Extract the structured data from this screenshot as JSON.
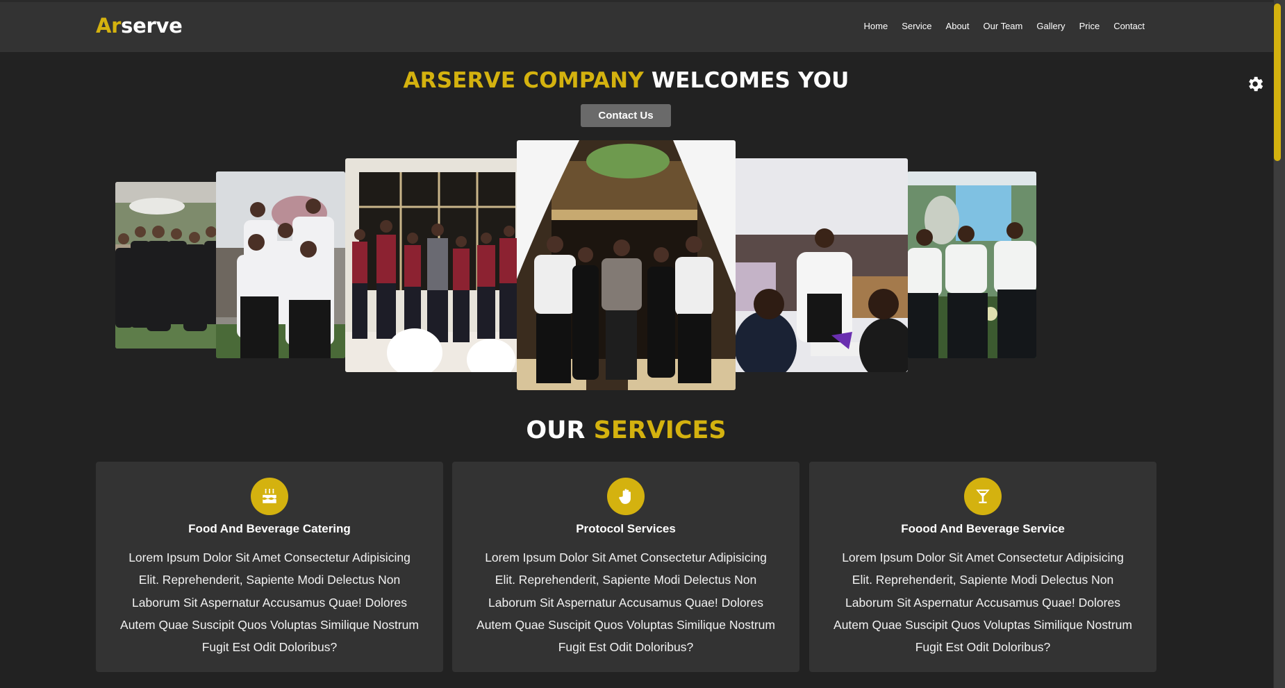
{
  "brand": {
    "logo_accent": "Ar",
    "logo_rest": "serve",
    "accent_color": "#d4b20f"
  },
  "nav": {
    "items": [
      {
        "label": "Home"
      },
      {
        "label": "Service"
      },
      {
        "label": "About"
      },
      {
        "label": "Our Team"
      },
      {
        "label": "Gallery"
      },
      {
        "label": "Price"
      },
      {
        "label": "Contact"
      }
    ]
  },
  "settings": {
    "icon": "gear-icon"
  },
  "hero": {
    "title_accent": "ARSERVE COMPANY",
    "title_rest": "WELCOMES YOU",
    "cta_label": "Contact Us"
  },
  "carousel": {
    "slides": [
      {
        "alt": "Team of waiters in black uniforms standing in garden"
      },
      {
        "alt": "Waitresses in white shirts and bow ties"
      },
      {
        "alt": "Staff in red vests lined up indoors"
      },
      {
        "alt": "Five staff members in formal wear at entrance"
      },
      {
        "alt": "Waitress serving a table at an event"
      },
      {
        "alt": "Three waiters giving thumbs up"
      }
    ]
  },
  "services": {
    "title_rest": "OUR",
    "title_accent": "SERVICES",
    "cards": [
      {
        "icon": "birthday-cake-icon",
        "title": "Food And Beverage Catering",
        "lines": [
          "Lorem Ipsum Dolor Sit Amet Consectetur Adipisicing",
          "Elit. Reprehenderit, Sapiente Modi Delectus Non",
          "Laborum Sit Aspernatur Accusamus Quae! Dolores",
          "Autem Quae Suscipit Quos Voluptas Similique Nostrum",
          "Fugit Est Odit Doloribus?"
        ]
      },
      {
        "icon": "hand-icon",
        "title": "Protocol Services",
        "lines": [
          "Lorem Ipsum Dolor Sit Amet Consectetur Adipisicing",
          "Elit. Reprehenderit, Sapiente Modi Delectus Non",
          "Laborum Sit Aspernatur Accusamus Quae! Dolores",
          "Autem Quae Suscipit Quos Voluptas Similique Nostrum",
          "Fugit Est Odit Doloribus?"
        ]
      },
      {
        "icon": "cocktail-glass-icon",
        "title": "Foood And Beverage Service",
        "lines": [
          "Lorem Ipsum Dolor Sit Amet Consectetur Adipisicing",
          "Elit. Reprehenderit, Sapiente Modi Delectus Non",
          "Laborum Sit Aspernatur Accusamus Quae! Dolores",
          "Autem Quae Suscipit Quos Voluptas Similique Nostrum",
          "Fugit Est Odit Doloribus?"
        ]
      }
    ]
  }
}
